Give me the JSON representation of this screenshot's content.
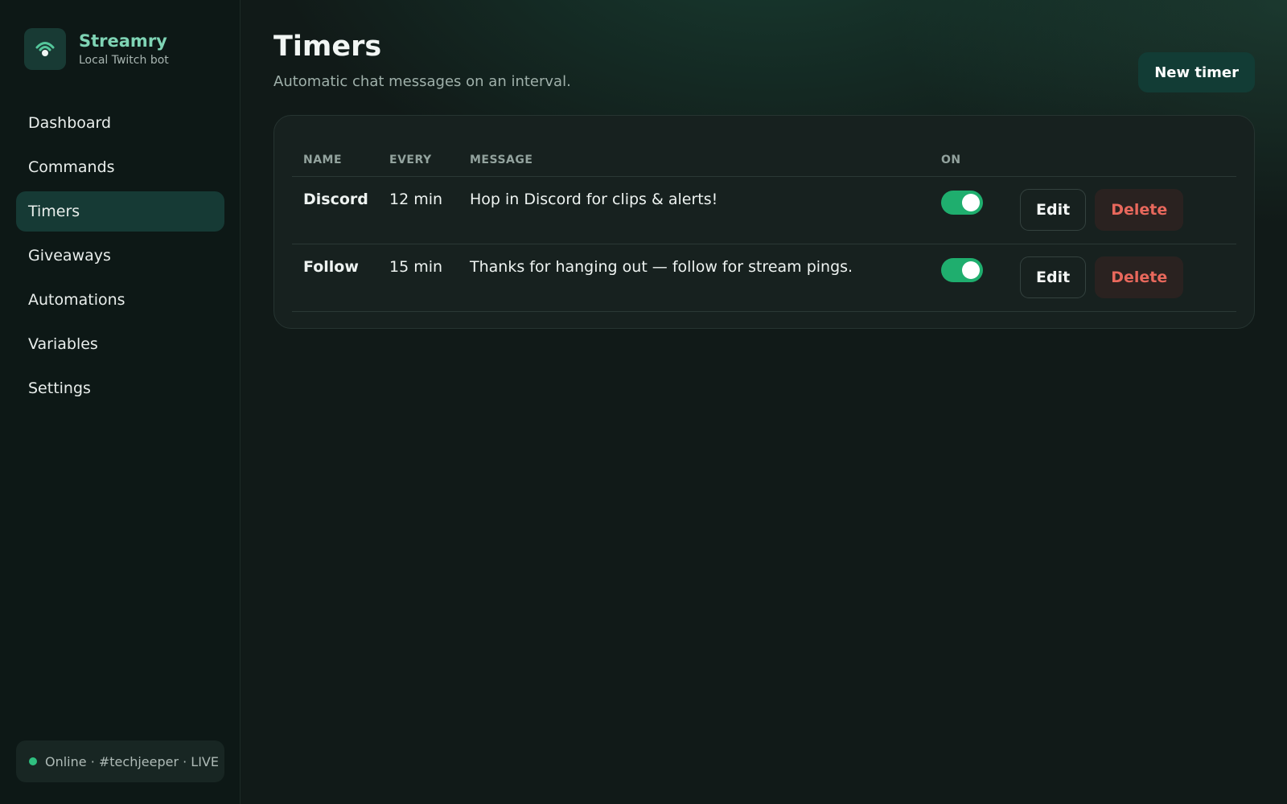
{
  "brand": {
    "name": "Streamry",
    "subtitle": "Local Twitch bot",
    "logo_icon": "signal-antenna-icon",
    "accent": "#7fd4b5"
  },
  "sidebar": {
    "items": [
      {
        "label": "Dashboard",
        "active": false
      },
      {
        "label": "Commands",
        "active": false
      },
      {
        "label": "Timers",
        "active": true
      },
      {
        "label": "Giveaways",
        "active": false
      },
      {
        "label": "Automations",
        "active": false
      },
      {
        "label": "Variables",
        "active": false
      },
      {
        "label": "Settings",
        "active": false
      }
    ],
    "status": {
      "text": "Online · #techjeeper · LIVE",
      "color": "#2fbf7f"
    }
  },
  "main": {
    "title": "Timers",
    "subtitle": "Automatic chat messages on an interval.",
    "new_button_label": "New timer",
    "table": {
      "columns": [
        "NAME",
        "EVERY",
        "MESSAGE",
        "ON"
      ],
      "rows": [
        {
          "name": "Discord",
          "every": "12 min",
          "message": "Hop in Discord for clips & alerts!",
          "on": true,
          "edit_label": "Edit",
          "delete_label": "Delete"
        },
        {
          "name": "Follow",
          "every": "15 min",
          "message": "Thanks for hanging out — follow for stream pings.",
          "on": true,
          "edit_label": "Edit",
          "delete_label": "Delete"
        }
      ]
    }
  },
  "colors": {
    "toggle_on": "#1fae6e",
    "delete_text": "#e8685c"
  }
}
